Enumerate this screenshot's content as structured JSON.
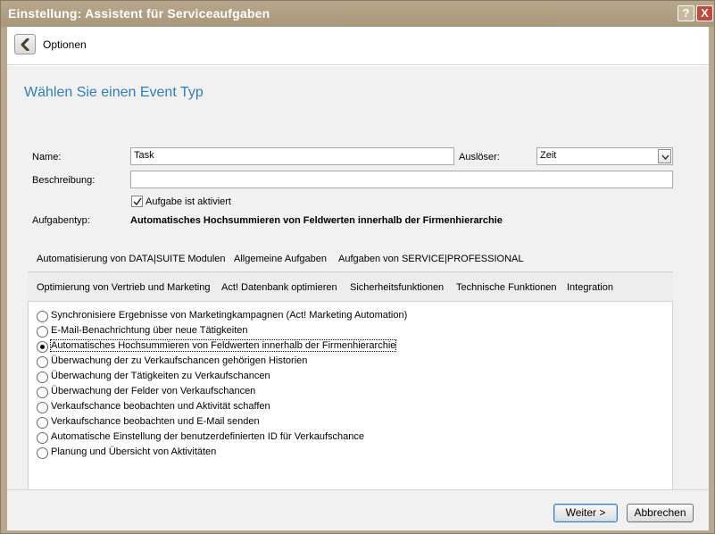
{
  "window": {
    "title": "Einstellung: Assistent für Serviceaufgaben",
    "help_label": "?",
    "close_label": "X"
  },
  "nav": {
    "label": "Optionen"
  },
  "heading": "Wählen Sie einen Event Typ",
  "form": {
    "name_label": "Name:",
    "name_value": "Task",
    "trigger_label": "Auslöser:",
    "trigger_value": "Zeit",
    "description_label": "Beschreibung:",
    "description_value": "",
    "active_label": "Aufgabe ist aktiviert",
    "active_checked": true,
    "type_label": "Aufgabentyp:",
    "type_value": "Automatisches Hochsummieren von Feldwerten innerhalb der Firmenhierarchie"
  },
  "tabs_top": [
    {
      "label": "Automatisierung von DATA|SUITE Modulen"
    },
    {
      "label": "Allgemeine Aufgaben"
    },
    {
      "label": "Aufgaben von SERVICE|PROFESSIONAL"
    }
  ],
  "tabs_sub": [
    {
      "label": "Optimierung von Vertrieb und Marketing"
    },
    {
      "label": "Act! Datenbank optimieren"
    },
    {
      "label": "Sicherheitsfunktionen"
    },
    {
      "label": "Technische Funktionen"
    },
    {
      "label": "Integration"
    }
  ],
  "options": [
    {
      "label": "Synchronisiere Ergebnisse von Marketingkampagnen (Act! Marketing Automation)",
      "selected": false
    },
    {
      "label": "E-Mail-Benachrichtung über neue Tätigkeiten",
      "selected": false
    },
    {
      "label": "Automatisches Hochsummieren von Feldwerten innerhalb der Firmenhierarchie",
      "selected": true
    },
    {
      "label": "Überwachung der zu Verkaufschancen gehörigen Historien",
      "selected": false
    },
    {
      "label": "Überwachung der Tätigkeiten zu Verkaufschancen",
      "selected": false
    },
    {
      "label": "Überwachung der Felder von Verkaufschancen",
      "selected": false
    },
    {
      "label": "Verkaufschance beobachten und Aktivität schaffen",
      "selected": false
    },
    {
      "label": "Verkaufschance beobachten und E-Mail senden",
      "selected": false
    },
    {
      "label": "Automatische Einstellung der benutzerdefinierten ID für Verkaufschance",
      "selected": false
    },
    {
      "label": "Planung und Übersicht von Aktivitäten",
      "selected": false
    }
  ],
  "footer": {
    "next_label": "Weiter >",
    "cancel_label": "Abbrechen"
  }
}
